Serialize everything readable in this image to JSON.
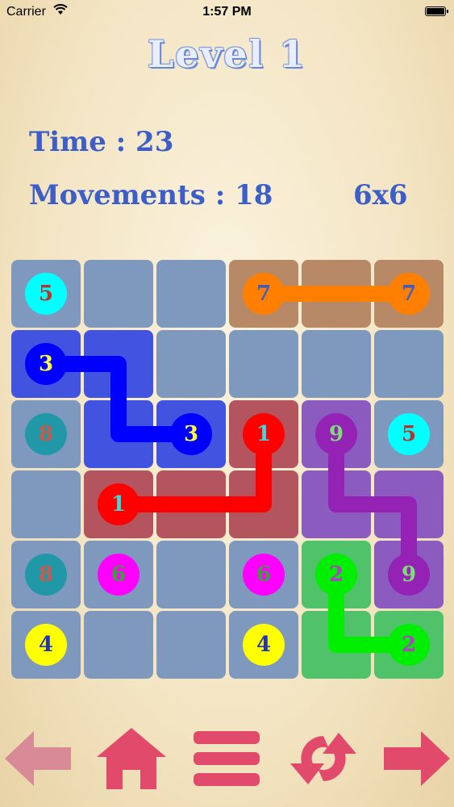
{
  "status_bar": {
    "carrier": "Carrier",
    "time": "1:57 PM"
  },
  "header": {
    "level_title": "Level  1",
    "time_text": "Time : 23",
    "movements_text": "Movements : 18",
    "grid_size": "6x6"
  },
  "colors": {
    "empty_cell": "#7f99be",
    "toolbar": "#e24a6c",
    "toolbar_back": "#d98a97"
  },
  "cells": [
    {
      "r": 0,
      "c": 3,
      "color": "#b78967"
    },
    {
      "r": 0,
      "c": 4,
      "color": "#b78967"
    },
    {
      "r": 0,
      "c": 5,
      "color": "#b78967"
    },
    {
      "r": 1,
      "c": 0,
      "color": "#4253e0"
    },
    {
      "r": 1,
      "c": 1,
      "color": "#4253e0"
    },
    {
      "r": 2,
      "c": 1,
      "color": "#4253e0"
    },
    {
      "r": 2,
      "c": 2,
      "color": "#4253e0"
    },
    {
      "r": 2,
      "c": 3,
      "color": "#b3545e"
    },
    {
      "r": 2,
      "c": 4,
      "color": "#8c5bbf"
    },
    {
      "r": 3,
      "c": 1,
      "color": "#b3545e"
    },
    {
      "r": 3,
      "c": 2,
      "color": "#b3545e"
    },
    {
      "r": 3,
      "c": 3,
      "color": "#b3545e"
    },
    {
      "r": 3,
      "c": 4,
      "color": "#8c5bbf"
    },
    {
      "r": 3,
      "c": 5,
      "color": "#8c5bbf"
    },
    {
      "r": 4,
      "c": 4,
      "color": "#4fc26a"
    },
    {
      "r": 4,
      "c": 5,
      "color": "#8c5bbf"
    },
    {
      "r": 5,
      "c": 4,
      "color": "#4fc26a"
    },
    {
      "r": 5,
      "c": 5,
      "color": "#4fc26a"
    }
  ],
  "paths": [
    {
      "color": "#ff7f00",
      "cells": [
        [
          0,
          3
        ],
        [
          0,
          5
        ]
      ]
    },
    {
      "color": "#0000ff",
      "cells": [
        [
          1,
          0
        ],
        [
          1,
          1
        ],
        [
          2,
          1
        ],
        [
          2,
          2
        ]
      ]
    },
    {
      "color": "#ff0000",
      "cells": [
        [
          3,
          1
        ],
        [
          3,
          3
        ],
        [
          2,
          3
        ]
      ]
    },
    {
      "color": "#9422b4",
      "cells": [
        [
          2,
          4
        ],
        [
          3,
          4
        ],
        [
          3,
          5
        ],
        [
          4,
          5
        ]
      ]
    },
    {
      "color": "#00ee00",
      "cells": [
        [
          4,
          4
        ],
        [
          5,
          4
        ],
        [
          5,
          5
        ]
      ]
    }
  ],
  "dots": [
    {
      "r": 0,
      "c": 0,
      "label": "5",
      "bg": "#00ffff",
      "fg": "#c0302c"
    },
    {
      "r": 0,
      "c": 3,
      "label": "7",
      "bg": "#ff7f00",
      "fg": "#3a5ec8"
    },
    {
      "r": 0,
      "c": 5,
      "label": "7",
      "bg": "#ff7f00",
      "fg": "#3a5ec8"
    },
    {
      "r": 1,
      "c": 0,
      "label": "3",
      "bg": "#0000ff",
      "fg": "#ffff3a"
    },
    {
      "r": 2,
      "c": 0,
      "label": "8",
      "bg": "#2098a8",
      "fg": "#c75a4a"
    },
    {
      "r": 2,
      "c": 2,
      "label": "3",
      "bg": "#0000ff",
      "fg": "#ffff3a"
    },
    {
      "r": 2,
      "c": 3,
      "label": "1",
      "bg": "#ff0000",
      "fg": "#40d8d8"
    },
    {
      "r": 2,
      "c": 4,
      "label": "9",
      "bg": "#9422b4",
      "fg": "#7fdc7a"
    },
    {
      "r": 2,
      "c": 5,
      "label": "5",
      "bg": "#00ffff",
      "fg": "#c0302c"
    },
    {
      "r": 3,
      "c": 1,
      "label": "1",
      "bg": "#ff0000",
      "fg": "#40d8d8"
    },
    {
      "r": 4,
      "c": 0,
      "label": "8",
      "bg": "#2098a8",
      "fg": "#c75a4a"
    },
    {
      "r": 4,
      "c": 1,
      "label": "6",
      "bg": "#ff00ff",
      "fg": "#3b9e3a"
    },
    {
      "r": 4,
      "c": 3,
      "label": "6",
      "bg": "#ff00ff",
      "fg": "#3b9e3a"
    },
    {
      "r": 4,
      "c": 4,
      "label": "2",
      "bg": "#00ee00",
      "fg": "#b43ec8"
    },
    {
      "r": 4,
      "c": 5,
      "label": "9",
      "bg": "#9422b4",
      "fg": "#7fdc7a"
    },
    {
      "r": 5,
      "c": 0,
      "label": "4",
      "bg": "#ffff00",
      "fg": "#2233b8"
    },
    {
      "r": 5,
      "c": 3,
      "label": "4",
      "bg": "#ffff00",
      "fg": "#2233b8"
    },
    {
      "r": 5,
      "c": 5,
      "label": "2",
      "bg": "#00ee00",
      "fg": "#b43ec8"
    }
  ],
  "toolbar": [
    {
      "name": "back-arrow-icon"
    },
    {
      "name": "home-icon"
    },
    {
      "name": "menu-icon"
    },
    {
      "name": "restart-icon"
    },
    {
      "name": "next-arrow-icon"
    }
  ]
}
